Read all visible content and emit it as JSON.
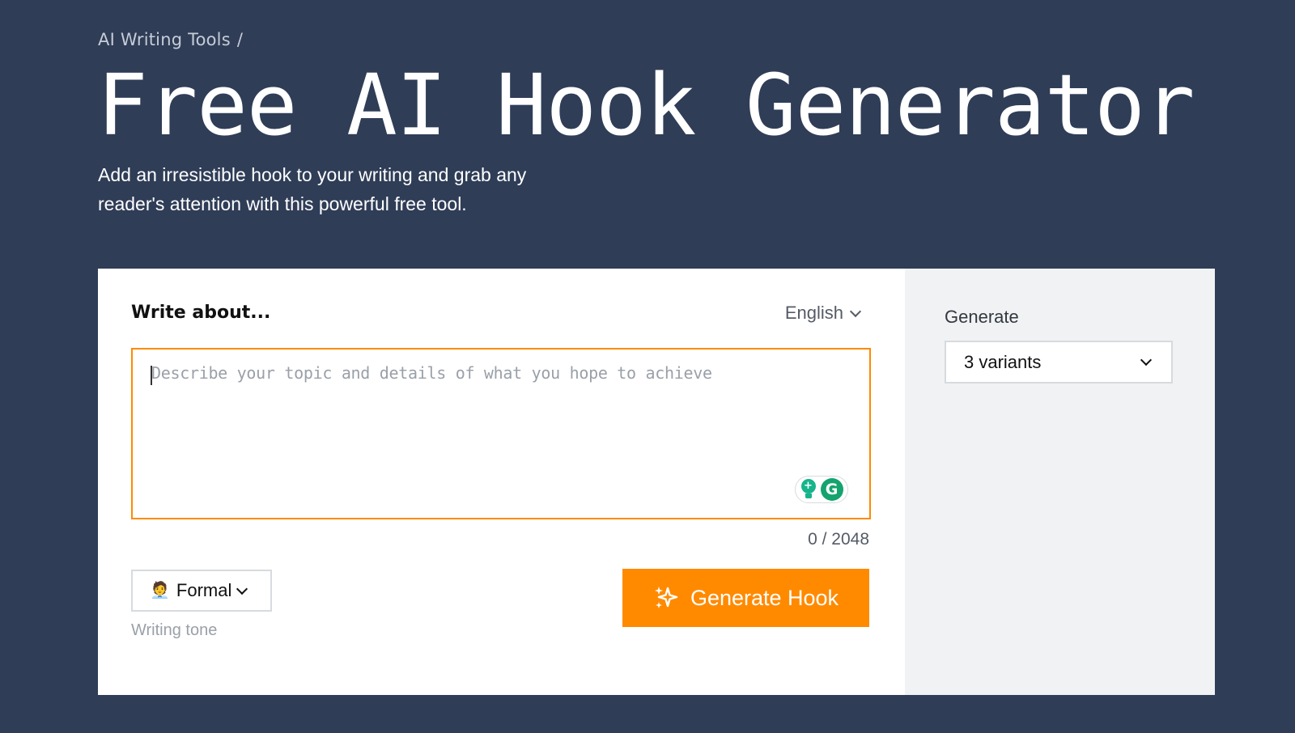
{
  "breadcrumb": {
    "section": "AI Writing Tools",
    "separator": "/"
  },
  "header": {
    "title": "Free AI Hook Generator",
    "subtitle": "Add an irresistible hook to your writing and grab any reader's attention with this powerful free tool."
  },
  "form": {
    "write_label": "Write about...",
    "language": "English",
    "textarea": {
      "value": "",
      "placeholder": "Describe your topic and details of what you hope to achieve"
    },
    "char_count": "0 / 2048",
    "tone": {
      "icon": "office-worker-emoji",
      "emoji": "🧑‍💼",
      "value": "Formal",
      "caption": "Writing tone"
    },
    "generate_button": {
      "icon": "sparkles-icon",
      "label": "Generate Hook"
    },
    "grammarly": {
      "bulb_glyph": "+",
      "logo_glyph": "G"
    }
  },
  "sidebar": {
    "generate_label": "Generate",
    "variants_value": "3 variants"
  },
  "colors": {
    "background": "#2f3d57",
    "accent": "#ff8a00",
    "panel": "#f1f2f4",
    "grammarly_green": "#15a36f"
  }
}
